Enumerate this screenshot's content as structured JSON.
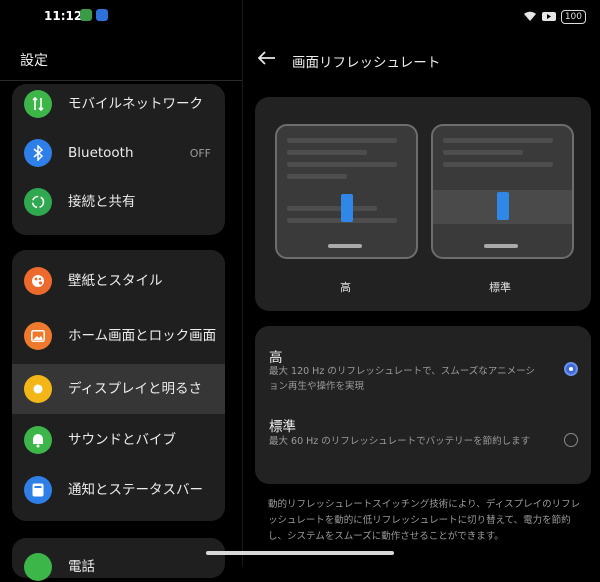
{
  "status": {
    "time": "11:12",
    "battery": "100",
    "accent_blue": "#2f87e8"
  },
  "left": {
    "title": "設定",
    "groups": [
      {
        "items": [
          {
            "label": "モバイルネットワーク",
            "icon": "mobile-data-icon",
            "color": "#3cb649"
          },
          {
            "label": "Bluetooth",
            "value": "OFF",
            "icon": "bluetooth-icon",
            "color": "#2f7fe8"
          },
          {
            "label": "接続と共有",
            "icon": "connection-share-icon",
            "color": "#2fa84f"
          }
        ]
      },
      {
        "items": [
          {
            "label": "壁紙とスタイル",
            "icon": "palette-icon",
            "color": "#ee6a2c"
          },
          {
            "label": "ホーム画面とロック画面",
            "icon": "image-icon",
            "color": "#ef7a2e"
          },
          {
            "label": "ディスプレイと明るさ",
            "icon": "sun-icon",
            "color": "#f3b619"
          },
          {
            "label": "サウンドとバイブ",
            "icon": "bell-icon",
            "color": "#3cb649"
          },
          {
            "label": "通知とステータスバー",
            "icon": "notification-icon",
            "color": "#2f7fe8"
          }
        ]
      }
    ],
    "partial_item": "電話"
  },
  "right": {
    "title": "画面リフレッシュレート",
    "preview_captions": [
      "高",
      "標準"
    ],
    "options": [
      {
        "title": "高",
        "desc": "最大 120 Hz のリフレッシュレートで、スムーズなアニメーション再生や操作を実現",
        "selected": true
      },
      {
        "title": "標準",
        "desc": "最大 60 Hz のリフレッシュレートでバッテリーを節約します",
        "selected": false
      }
    ],
    "footer": "動的リフレッシュレートスイッチング技術により、ディスプレイのリフレッシュレートを動的に低リフレッシュレートに切り替えて、電力を節約し、システムをスムーズに動作させることができます。"
  }
}
